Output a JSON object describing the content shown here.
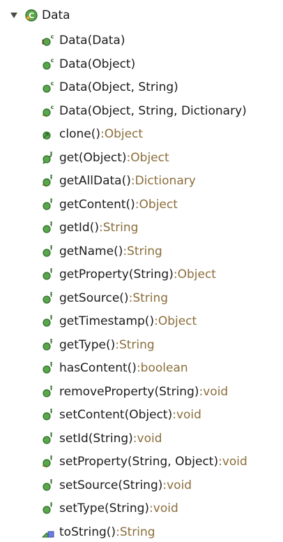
{
  "tree": {
    "root": {
      "label": "Data",
      "expanded": true,
      "icon": "class-icon"
    },
    "members": [
      {
        "name": "Data(Data)",
        "return_type": "",
        "icon": "constructor-private-icon"
      },
      {
        "name": "Data(Object)",
        "return_type": "",
        "icon": "constructor-public-icon"
      },
      {
        "name": "Data(Object, String)",
        "return_type": "",
        "icon": "constructor-public-icon"
      },
      {
        "name": "Data(Object, String, Dictionary)",
        "return_type": "",
        "icon": "constructor-protected-icon"
      },
      {
        "name": "clone()",
        "return_type": "Object",
        "icon": "method-overrides-icon"
      },
      {
        "name": "get(Object)",
        "return_type": "Object",
        "icon": "method-default-icon"
      },
      {
        "name": "getAllData()",
        "return_type": "Dictionary",
        "icon": "method-protected-icon"
      },
      {
        "name": "getContent()",
        "return_type": "Object",
        "icon": "method-public-icon"
      },
      {
        "name": "getId()",
        "return_type": "String",
        "icon": "method-public-icon"
      },
      {
        "name": "getName()",
        "return_type": "String",
        "icon": "method-public-icon"
      },
      {
        "name": "getProperty(String)",
        "return_type": "Object",
        "icon": "method-public-icon"
      },
      {
        "name": "getSource()",
        "return_type": "String",
        "icon": "method-public-icon"
      },
      {
        "name": "getTimestamp()",
        "return_type": "Object",
        "icon": "method-public-icon"
      },
      {
        "name": "getType()",
        "return_type": "String",
        "icon": "method-public-icon"
      },
      {
        "name": "hasContent()",
        "return_type": "boolean",
        "icon": "method-public-icon"
      },
      {
        "name": "removeProperty(String)",
        "return_type": "void",
        "icon": "method-public-icon"
      },
      {
        "name": "setContent(Object)",
        "return_type": "void",
        "icon": "method-public-icon"
      },
      {
        "name": "setId(String)",
        "return_type": "void",
        "icon": "method-public-icon"
      },
      {
        "name": "setProperty(String, Object)",
        "return_type": "void",
        "icon": "method-protected-icon"
      },
      {
        "name": "setSource(String)",
        "return_type": "void",
        "icon": "method-public-icon"
      },
      {
        "name": "setType(String)",
        "return_type": "void",
        "icon": "method-public-icon"
      },
      {
        "name": "toString()",
        "return_type": "String",
        "icon": "method-overrides-up-icon"
      }
    ],
    "separator": " : "
  },
  "colors": {
    "text": "#1b1b1b",
    "return_type": "#8a6d3b",
    "public_green": "#3a9a3a",
    "protected_yellow": "#d7a21a",
    "private_red": "#c43a2e"
  }
}
